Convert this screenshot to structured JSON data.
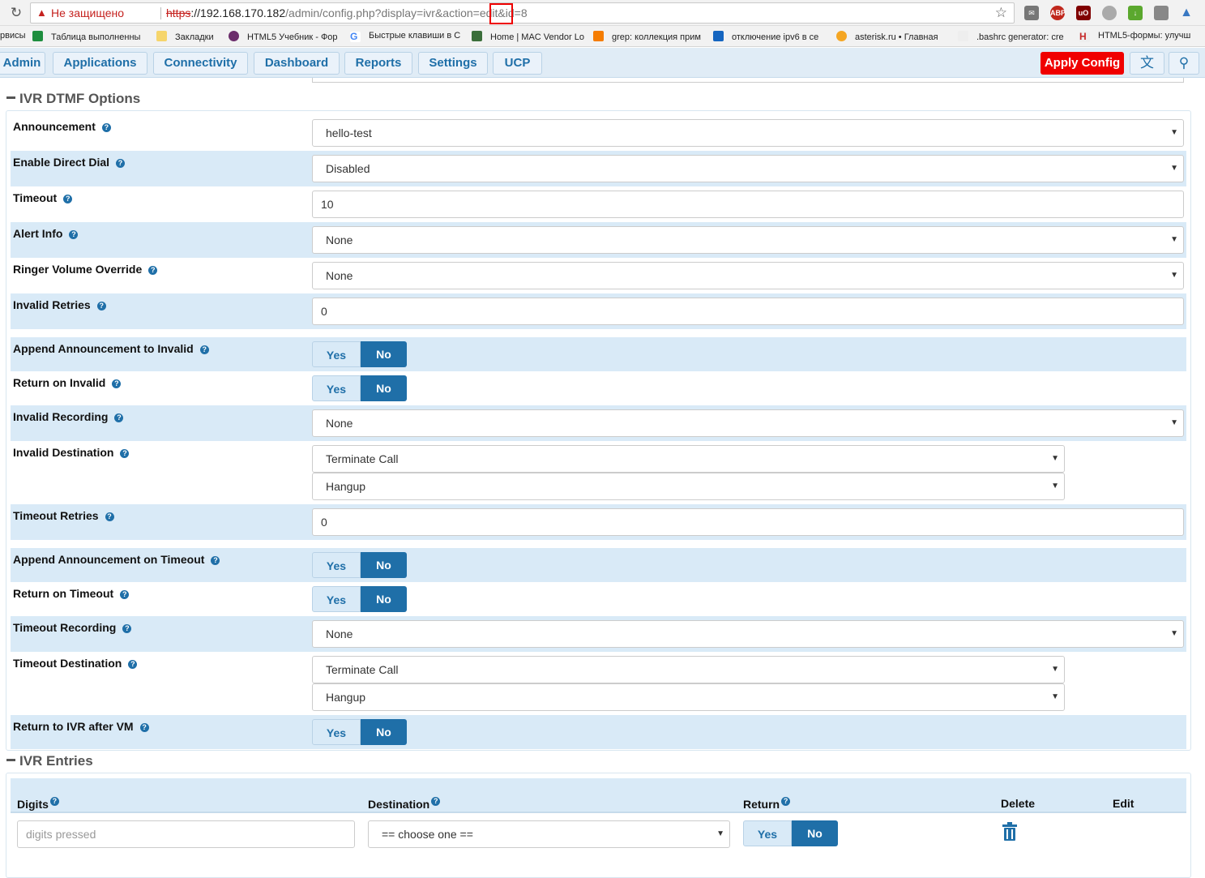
{
  "browser": {
    "insecure_label": "Не защищено",
    "url_scheme": "https",
    "url_host": "://192.168.170.182",
    "url_path": "/admin/config.php?display=ivr&action=edit&id",
    "url_id": "=8",
    "extensions": [
      "mail-icon",
      "abp-icon",
      "ublock-icon",
      "hat-icon",
      "download-icon",
      "clipboard-icon",
      "vpn-icon"
    ],
    "bookmarks": [
      {
        "label": "рвисы",
        "icon": "none"
      },
      {
        "label": "Таблица выполненны",
        "icon": "sheets-icon"
      },
      {
        "label": "Закладки",
        "icon": "folder-icon"
      },
      {
        "label": "HTML5 Учебник - Фор",
        "icon": "html-icon"
      },
      {
        "label": "Быстрые клавиши в С",
        "icon": "google-icon"
      },
      {
        "label": "Home | MAC Vendor Lo",
        "icon": "mac-icon"
      },
      {
        "label": "grep: коллекция прим",
        "icon": "grep-icon"
      },
      {
        "label": "отключение ipv6 в се",
        "icon": "wave-icon"
      },
      {
        "label": "asterisk.ru • Главная",
        "icon": "asterisk-icon"
      },
      {
        "label": ".bashrc generator: cre",
        "icon": "bash-icon"
      },
      {
        "label": "HTML5-формы: улучш",
        "icon": "h-icon"
      }
    ]
  },
  "nav": {
    "items": [
      "Admin",
      "Applications",
      "Connectivity",
      "Dashboard",
      "Reports",
      "Settings",
      "UCP"
    ],
    "apply_label": "Apply Config"
  },
  "dtmf": {
    "title": "IVR DTMF Options",
    "announcement": {
      "label": "Announcement",
      "value": "hello-test"
    },
    "direct_dial": {
      "label": "Enable Direct Dial",
      "value": "Disabled"
    },
    "timeout": {
      "label": "Timeout",
      "value": "10"
    },
    "alert_info": {
      "label": "Alert Info",
      "value": "None"
    },
    "ringer_volume": {
      "label": "Ringer Volume Override",
      "value": "None"
    },
    "invalid_retries": {
      "label": "Invalid Retries",
      "value": "0"
    },
    "append_invalid": {
      "label": "Append Announcement to Invalid",
      "value": "No"
    },
    "return_invalid": {
      "label": "Return on Invalid",
      "value": "No"
    },
    "invalid_recording": {
      "label": "Invalid Recording",
      "value": "None"
    },
    "invalid_destination": {
      "label": "Invalid Destination",
      "value": "Terminate Call",
      "sub_value": "Hangup"
    },
    "timeout_retries": {
      "label": "Timeout Retries",
      "value": "0"
    },
    "append_timeout": {
      "label": "Append Announcement on Timeout",
      "value": "No"
    },
    "return_timeout": {
      "label": "Return on Timeout",
      "value": "No"
    },
    "timeout_recording": {
      "label": "Timeout Recording",
      "value": "None"
    },
    "timeout_destination": {
      "label": "Timeout Destination",
      "value": "Terminate Call",
      "sub_value": "Hangup"
    },
    "return_ivr_vm": {
      "label": "Return to IVR after VM",
      "value": "No"
    }
  },
  "toggle": {
    "yes": "Yes",
    "no": "No"
  },
  "entries": {
    "title": "IVR Entries",
    "columns": [
      "Digits",
      "Destination",
      "Return",
      "Delete",
      "Edit"
    ],
    "digits_placeholder": "digits pressed",
    "destination_value": "== choose one =="
  }
}
